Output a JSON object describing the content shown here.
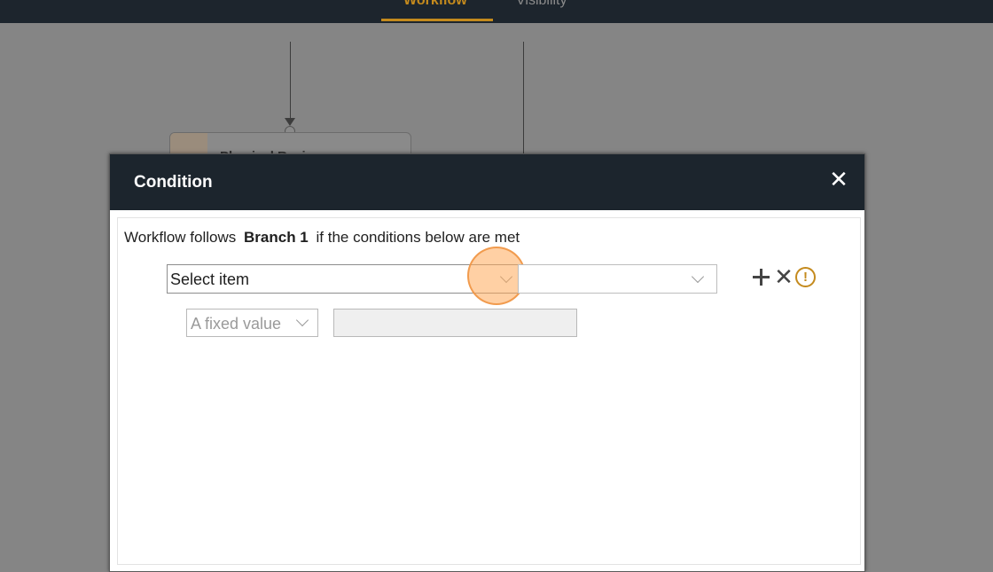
{
  "nav": {
    "tabs": [
      {
        "label": "Workflow",
        "active": true
      },
      {
        "label": "Visibility",
        "active": false
      }
    ],
    "accent_color": "#c48a1d"
  },
  "canvas": {
    "step_card_title": "Physical Review"
  },
  "modal": {
    "title": "Condition",
    "close_icon": "close-icon",
    "sentence": {
      "prefix": "Workflow follows",
      "branch": "Branch 1",
      "suffix": "if the conditions below are met"
    },
    "condition_row": {
      "item_select": {
        "value": "Select item"
      },
      "operator_select": {
        "value": ""
      },
      "actions": [
        {
          "icon": "plus-icon"
        },
        {
          "icon": "close-icon"
        },
        {
          "icon": "warning-icon",
          "glyph": "!"
        }
      ]
    },
    "value_row": {
      "source_select": {
        "value": "A fixed value"
      },
      "value_input": {
        "value": ""
      }
    }
  }
}
